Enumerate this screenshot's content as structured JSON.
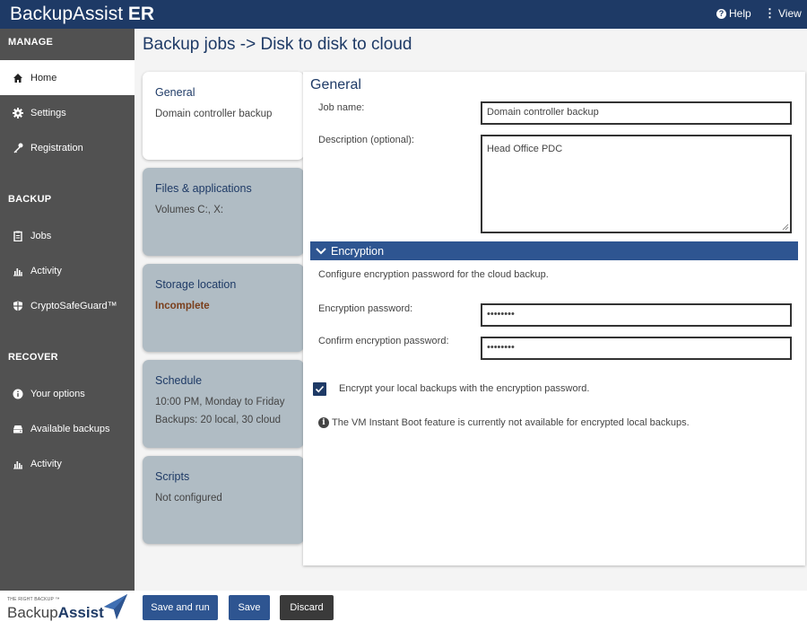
{
  "app": {
    "brand_main": "BackupAssist",
    "brand_suffix": "ER"
  },
  "header": {
    "help_label": "Help",
    "view_label": "View"
  },
  "sidebar": {
    "manage_label": "MANAGE",
    "manage_items": [
      {
        "label": "Home",
        "icon": "home-icon"
      },
      {
        "label": "Settings",
        "icon": "gear-icon"
      },
      {
        "label": "Registration",
        "icon": "key-icon"
      }
    ],
    "backup_label": "BACKUP",
    "backup_items": [
      {
        "label": "Jobs",
        "icon": "clipboard-icon"
      },
      {
        "label": "Activity",
        "icon": "bar-chart-icon"
      },
      {
        "label": "CryptoSafeGuard™",
        "icon": "shield-icon"
      }
    ],
    "recover_label": "RECOVER",
    "recover_items": [
      {
        "label": "Your options",
        "icon": "info-icon"
      },
      {
        "label": "Available backups",
        "icon": "drive-icon"
      },
      {
        "label": "Activity",
        "icon": "bar-chart-icon"
      }
    ]
  },
  "page": {
    "title": "Backup jobs -> Disk to disk to cloud"
  },
  "steps": [
    {
      "title": "General",
      "lines": [
        "Domain controller backup"
      ]
    },
    {
      "title": "Files & applications",
      "lines": [
        "Volumes C:, X:"
      ]
    },
    {
      "title": "Storage location",
      "lines": [
        "Incomplete"
      ]
    },
    {
      "title": "Schedule",
      "lines": [
        "10:00 PM, Monday to Friday",
        "Backups: 20 local, 30 cloud"
      ]
    },
    {
      "title": "Scripts",
      "lines": [
        "Not configured"
      ]
    }
  ],
  "general": {
    "heading": "General",
    "job_name_label": "Job name:",
    "job_name_value": "Domain controller backup",
    "description_label": "Description (optional):",
    "description_value": "Head Office PDC"
  },
  "encryption": {
    "heading": "Encryption",
    "description": "Configure encryption password for the cloud backup.",
    "password_label": "Encryption password:",
    "password_value": "••••••••",
    "confirm_label": "Confirm encryption password:",
    "confirm_value": "••••••••",
    "local_checkbox_label": "Encrypt your local backups with the encryption password.",
    "local_checkbox_checked": true,
    "info_text": "The VM Instant Boot feature is currently not available for encrypted local backups."
  },
  "footer": {
    "logo_tagline": "THE RIGHT BACKUP ™",
    "logo_main": "Backup",
    "logo_bold": "Assist",
    "save_and_run_label": "Save and run",
    "save_label": "Save",
    "discard_label": "Discard"
  },
  "colors": {
    "header": "#1e3a66",
    "accent": "#2e5591",
    "sidebar": "#515151",
    "incomplete": "#7a3f1c"
  }
}
